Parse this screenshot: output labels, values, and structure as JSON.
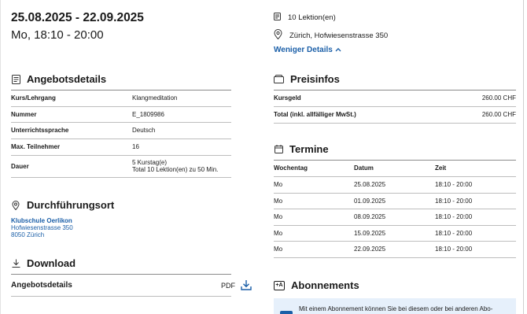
{
  "header": {
    "date_range": "25.08.2025 - 22.09.2025",
    "time": "Mo, 18:10 - 20:00",
    "lessons": "10 Lektion(en)",
    "location": "Zürich, Hofwiesenstrasse 350",
    "toggle_label": "Weniger Details"
  },
  "angebot": {
    "title": "Angebotsdetails",
    "rows": [
      {
        "label": "Kurs/Lehrgang",
        "value": "Klangmeditation"
      },
      {
        "label": "Nummer",
        "value": "E_1809986"
      },
      {
        "label": "Unterrichtssprache",
        "value": "Deutsch"
      },
      {
        "label": "Max. Teilnehmer",
        "value": "16"
      },
      {
        "label": "Dauer",
        "value": "5 Kurstag(e)",
        "value2": "Total 10 Lektion(en) zu 50 Min."
      }
    ]
  },
  "ort": {
    "title": "Durchführungsort",
    "name": "Klubschule Oerlikon",
    "street": "Hofwiesenstrasse 350",
    "city": "8050 Zürich"
  },
  "download": {
    "title": "Download",
    "item_label": "Angebotsdetails",
    "format": "PDF"
  },
  "preis": {
    "title": "Preisinfos",
    "rows": [
      {
        "label": "Kursgeld",
        "value": "260.00 CHF"
      },
      {
        "label": "Total (inkl. allfälliger MwSt.)",
        "value": "260.00 CHF"
      }
    ]
  },
  "termine": {
    "title": "Termine",
    "headers": [
      "Wochentag",
      "Datum",
      "Zeit"
    ],
    "rows": [
      [
        "Mo",
        "25.08.2025",
        "18:10 - 20:00"
      ],
      [
        "Mo",
        "01.09.2025",
        "18:10 - 20:00"
      ],
      [
        "Mo",
        "08.09.2025",
        "18:10 - 20:00"
      ],
      [
        "Mo",
        "15.09.2025",
        "18:10 - 20:00"
      ],
      [
        "Mo",
        "22.09.2025",
        "18:10 - 20:00"
      ]
    ]
  },
  "abo": {
    "title": "Abonnements",
    "icon_text": "+A",
    "text": "Mit einem Abonnement können Sie bei diesem oder bei anderen Abo-"
  },
  "colors": {
    "link": "#1b5fa8",
    "info_box": "#e6f0fb"
  },
  "icons": [
    "calendar-list-icon",
    "location-pin-icon",
    "chevron-up-icon",
    "document-icon",
    "wallet-icon",
    "calendar-icon",
    "download-icon",
    "subscription-icon"
  ]
}
